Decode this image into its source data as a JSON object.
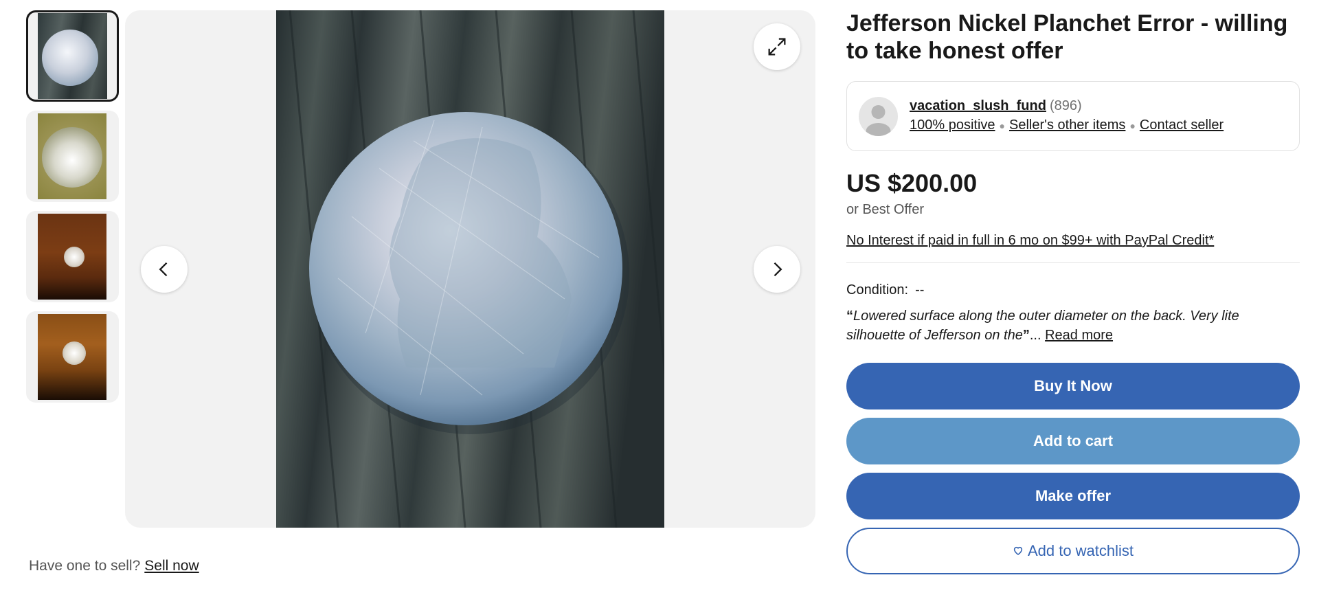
{
  "listing": {
    "title": "Jefferson Nickel Planchet Error - willing to take honest offer",
    "seller": {
      "name": "vacation_slush_fund",
      "feedback_count": "(896)",
      "positive": "100% positive",
      "other_items": "Seller's other items",
      "contact": "Contact seller"
    },
    "price": "US $200.00",
    "best_offer": "or Best Offer",
    "credit_offer": "No Interest if paid in full in 6 mo on $99+ with PayPal Credit*",
    "condition_label": "Condition:",
    "condition_value": "--",
    "description_quote": "Lowered surface along the outer diameter on the back. Very lite silhouette of Jefferson on the",
    "quote_open": "“",
    "quote_close": "”",
    "ellipsis": "...",
    "read_more": "Read more"
  },
  "buttons": {
    "buy_now": "Buy It Now",
    "add_to_cart": "Add to cart",
    "make_offer": "Make offer",
    "watchlist": "Add to watchlist"
  },
  "sell_prompt": {
    "text": "Have one to sell?",
    "link": "Sell now"
  },
  "gallery": {
    "thumbnail_count": 4,
    "active_index": 0,
    "icons": [
      "expand-icon",
      "chevron-left-icon",
      "chevron-right-icon"
    ]
  },
  "colors": {
    "primary": "#3665b3",
    "secondary": "#5d97c8",
    "text": "#191919"
  }
}
